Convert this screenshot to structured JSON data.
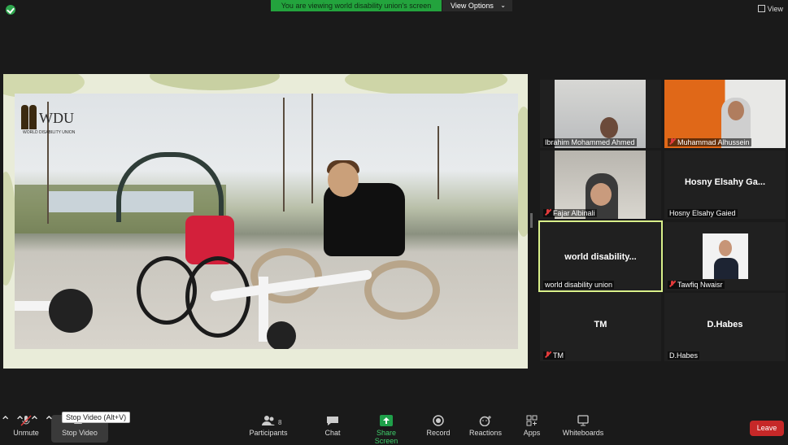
{
  "top_bar": {
    "banner_text": "You are viewing world disability union's screen",
    "view_options_label": "View Options",
    "view_label": "View"
  },
  "shared_screen": {
    "logo_text": "WDU",
    "logo_subtitle": "WORLD DISABILITY UNION"
  },
  "participants": [
    {
      "name": "Ibrahim Mohammed Ahmed",
      "muted": false,
      "video": true
    },
    {
      "name": "Muhammad Alhussein",
      "muted": true,
      "video": true
    },
    {
      "name": "Fajar Albinali",
      "muted": true,
      "video": true
    },
    {
      "name": "Hosny Elsahy Gaied",
      "display": "Hosny  Elsahy  Ga...",
      "muted": false,
      "video": false
    },
    {
      "name": "world disability union",
      "display": "world  disability...",
      "muted": false,
      "video": false,
      "active_speaker": true
    },
    {
      "name": "Tawfiq Nwaisr",
      "muted": true,
      "video": true
    },
    {
      "name": "TM",
      "display": "TM",
      "muted": true,
      "video": false
    },
    {
      "name": "D.Habes",
      "display": "D.Habes",
      "muted": false,
      "video": false
    }
  ],
  "tooltip": "Stop Video (Alt+V)",
  "toolbar": {
    "unmute": "Unmute",
    "stop_video": "Stop Video",
    "participants": "Participants",
    "participants_count": "8",
    "chat": "Chat",
    "share_screen": "Share Screen",
    "record": "Record",
    "reactions": "Reactions",
    "apps": "Apps",
    "whiteboards": "Whiteboards",
    "leave": "Leave"
  },
  "colors": {
    "banner_green": "#23a33d",
    "leave_red": "#c62828",
    "active_border": "#d9f08a",
    "muted_red": "#e23b3b"
  }
}
